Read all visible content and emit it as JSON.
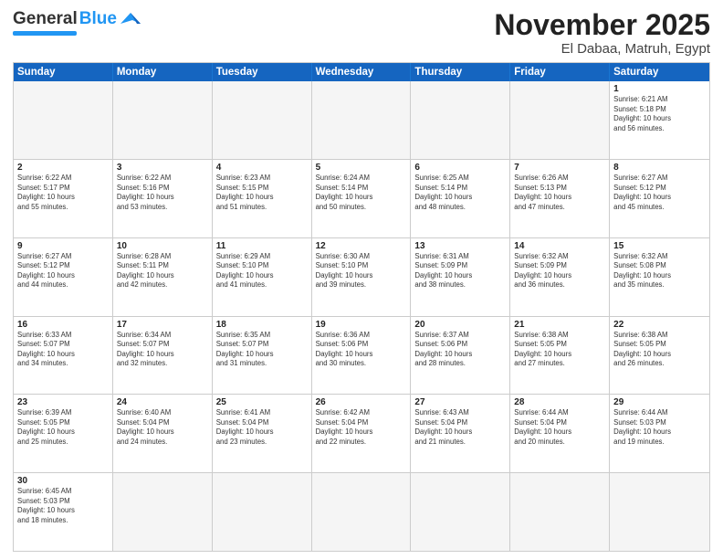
{
  "header": {
    "logo_general": "General",
    "logo_blue": "Blue",
    "month": "November 2025",
    "location": "El Dabaa, Matruh, Egypt"
  },
  "days_of_week": [
    "Sunday",
    "Monday",
    "Tuesday",
    "Wednesday",
    "Thursday",
    "Friday",
    "Saturday"
  ],
  "rows": [
    [
      {
        "day": "",
        "text": ""
      },
      {
        "day": "",
        "text": ""
      },
      {
        "day": "",
        "text": ""
      },
      {
        "day": "",
        "text": ""
      },
      {
        "day": "",
        "text": ""
      },
      {
        "day": "",
        "text": ""
      },
      {
        "day": "1",
        "text": "Sunrise: 6:21 AM\nSunset: 5:18 PM\nDaylight: 10 hours\nand 56 minutes."
      }
    ],
    [
      {
        "day": "2",
        "text": "Sunrise: 6:22 AM\nSunset: 5:17 PM\nDaylight: 10 hours\nand 55 minutes."
      },
      {
        "day": "3",
        "text": "Sunrise: 6:22 AM\nSunset: 5:16 PM\nDaylight: 10 hours\nand 53 minutes."
      },
      {
        "day": "4",
        "text": "Sunrise: 6:23 AM\nSunset: 5:15 PM\nDaylight: 10 hours\nand 51 minutes."
      },
      {
        "day": "5",
        "text": "Sunrise: 6:24 AM\nSunset: 5:14 PM\nDaylight: 10 hours\nand 50 minutes."
      },
      {
        "day": "6",
        "text": "Sunrise: 6:25 AM\nSunset: 5:14 PM\nDaylight: 10 hours\nand 48 minutes."
      },
      {
        "day": "7",
        "text": "Sunrise: 6:26 AM\nSunset: 5:13 PM\nDaylight: 10 hours\nand 47 minutes."
      },
      {
        "day": "8",
        "text": "Sunrise: 6:27 AM\nSunset: 5:12 PM\nDaylight: 10 hours\nand 45 minutes."
      }
    ],
    [
      {
        "day": "9",
        "text": "Sunrise: 6:27 AM\nSunset: 5:12 PM\nDaylight: 10 hours\nand 44 minutes."
      },
      {
        "day": "10",
        "text": "Sunrise: 6:28 AM\nSunset: 5:11 PM\nDaylight: 10 hours\nand 42 minutes."
      },
      {
        "day": "11",
        "text": "Sunrise: 6:29 AM\nSunset: 5:10 PM\nDaylight: 10 hours\nand 41 minutes."
      },
      {
        "day": "12",
        "text": "Sunrise: 6:30 AM\nSunset: 5:10 PM\nDaylight: 10 hours\nand 39 minutes."
      },
      {
        "day": "13",
        "text": "Sunrise: 6:31 AM\nSunset: 5:09 PM\nDaylight: 10 hours\nand 38 minutes."
      },
      {
        "day": "14",
        "text": "Sunrise: 6:32 AM\nSunset: 5:09 PM\nDaylight: 10 hours\nand 36 minutes."
      },
      {
        "day": "15",
        "text": "Sunrise: 6:32 AM\nSunset: 5:08 PM\nDaylight: 10 hours\nand 35 minutes."
      }
    ],
    [
      {
        "day": "16",
        "text": "Sunrise: 6:33 AM\nSunset: 5:07 PM\nDaylight: 10 hours\nand 34 minutes."
      },
      {
        "day": "17",
        "text": "Sunrise: 6:34 AM\nSunset: 5:07 PM\nDaylight: 10 hours\nand 32 minutes."
      },
      {
        "day": "18",
        "text": "Sunrise: 6:35 AM\nSunset: 5:07 PM\nDaylight: 10 hours\nand 31 minutes."
      },
      {
        "day": "19",
        "text": "Sunrise: 6:36 AM\nSunset: 5:06 PM\nDaylight: 10 hours\nand 30 minutes."
      },
      {
        "day": "20",
        "text": "Sunrise: 6:37 AM\nSunset: 5:06 PM\nDaylight: 10 hours\nand 28 minutes."
      },
      {
        "day": "21",
        "text": "Sunrise: 6:38 AM\nSunset: 5:05 PM\nDaylight: 10 hours\nand 27 minutes."
      },
      {
        "day": "22",
        "text": "Sunrise: 6:38 AM\nSunset: 5:05 PM\nDaylight: 10 hours\nand 26 minutes."
      }
    ],
    [
      {
        "day": "23",
        "text": "Sunrise: 6:39 AM\nSunset: 5:05 PM\nDaylight: 10 hours\nand 25 minutes."
      },
      {
        "day": "24",
        "text": "Sunrise: 6:40 AM\nSunset: 5:04 PM\nDaylight: 10 hours\nand 24 minutes."
      },
      {
        "day": "25",
        "text": "Sunrise: 6:41 AM\nSunset: 5:04 PM\nDaylight: 10 hours\nand 23 minutes."
      },
      {
        "day": "26",
        "text": "Sunrise: 6:42 AM\nSunset: 5:04 PM\nDaylight: 10 hours\nand 22 minutes."
      },
      {
        "day": "27",
        "text": "Sunrise: 6:43 AM\nSunset: 5:04 PM\nDaylight: 10 hours\nand 21 minutes."
      },
      {
        "day": "28",
        "text": "Sunrise: 6:44 AM\nSunset: 5:04 PM\nDaylight: 10 hours\nand 20 minutes."
      },
      {
        "day": "29",
        "text": "Sunrise: 6:44 AM\nSunset: 5:03 PM\nDaylight: 10 hours\nand 19 minutes."
      }
    ],
    [
      {
        "day": "30",
        "text": "Sunrise: 6:45 AM\nSunset: 5:03 PM\nDaylight: 10 hours\nand 18 minutes."
      },
      {
        "day": "",
        "text": ""
      },
      {
        "day": "",
        "text": ""
      },
      {
        "day": "",
        "text": ""
      },
      {
        "day": "",
        "text": ""
      },
      {
        "day": "",
        "text": ""
      },
      {
        "day": "",
        "text": ""
      }
    ]
  ]
}
